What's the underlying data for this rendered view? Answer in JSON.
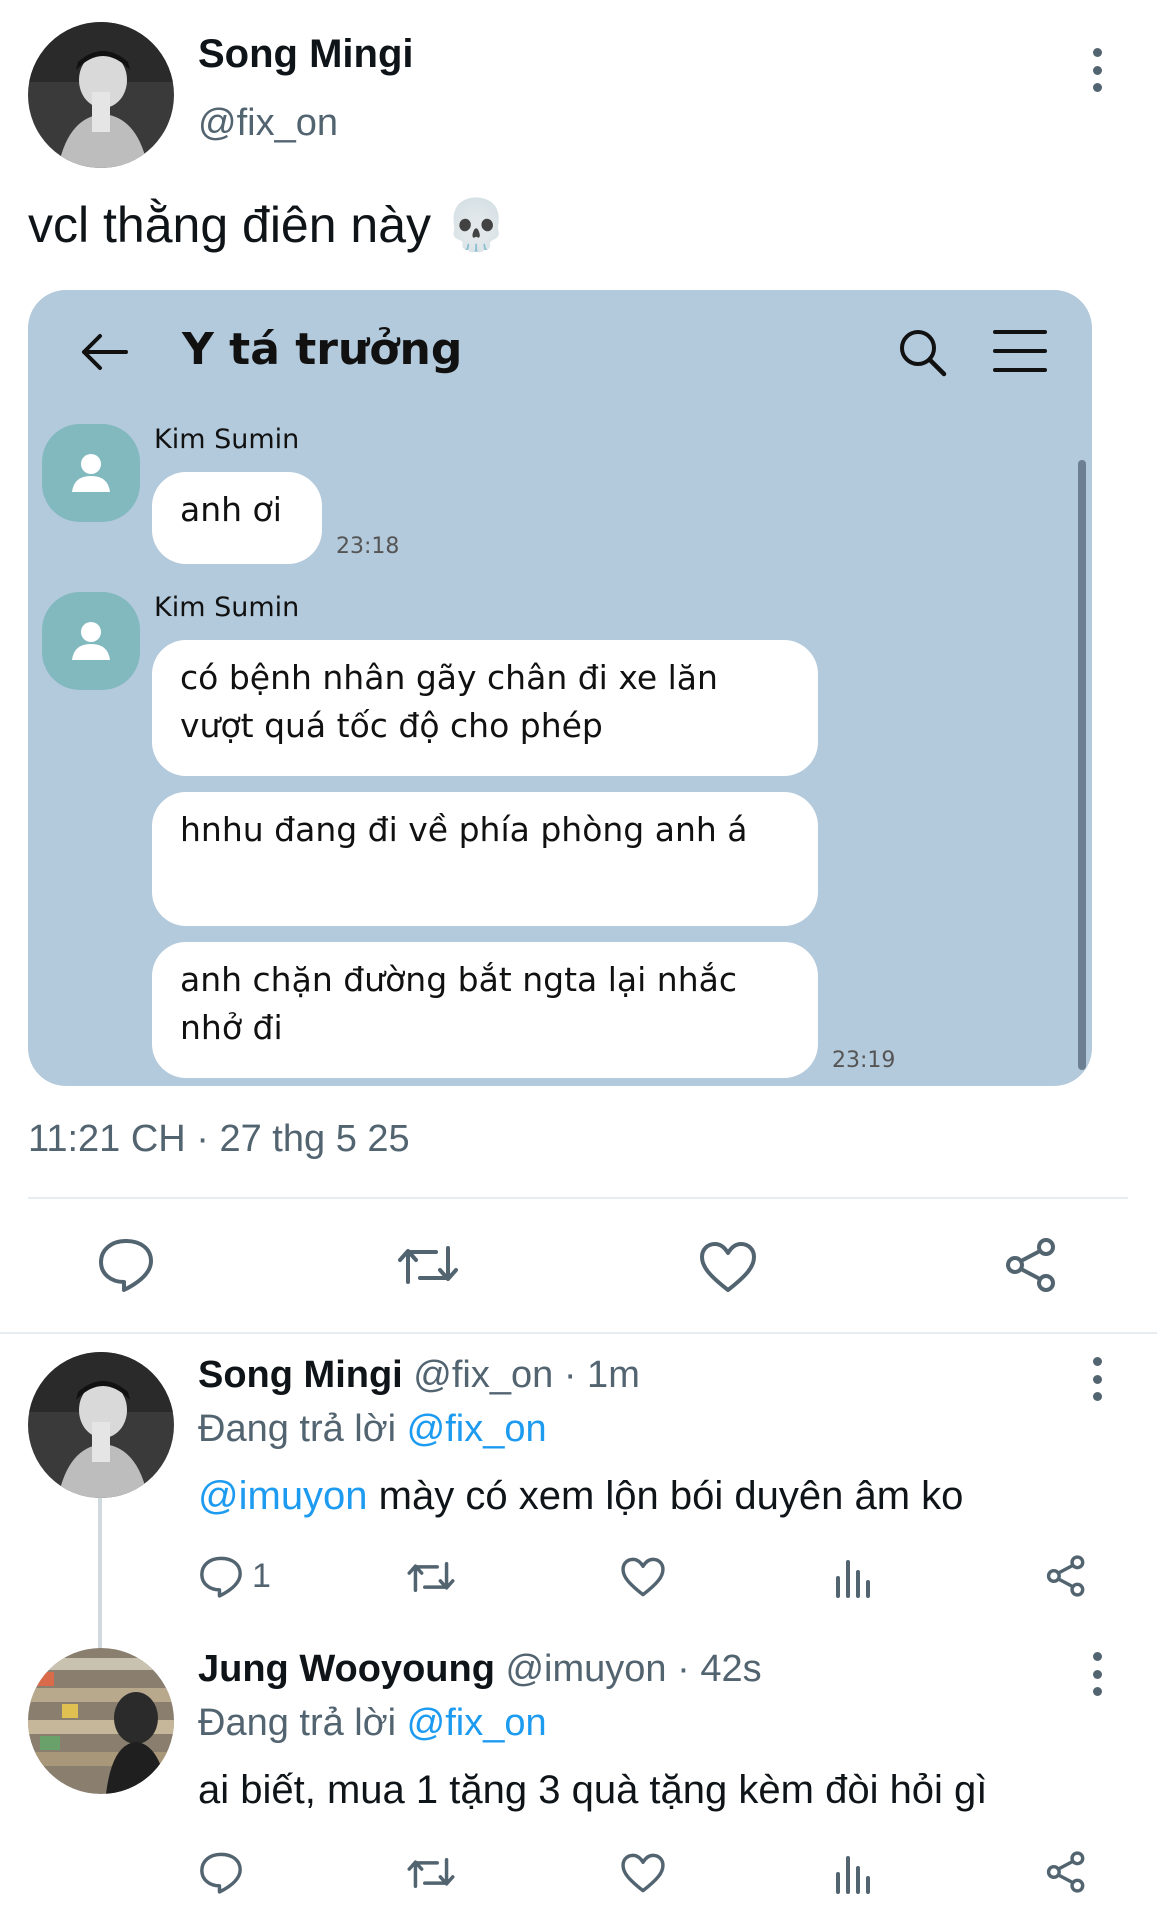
{
  "main_tweet": {
    "display_name": "Song Mingi",
    "handle": "@fix_on",
    "text": "vcl thằng điên này 💀",
    "timestamp": "11:21 CH · 27 thg 5 25"
  },
  "chat": {
    "title": "Y tá trưởng",
    "groups": [
      {
        "sender": "Kim Sumin",
        "messages": [
          "anh ơi"
        ],
        "time": "23:18"
      },
      {
        "sender": "Kim Sumin",
        "messages": [
          "có bệnh nhân gãy chân đi xe lăn vượt quá tốc độ cho phép",
          "hnhu đang đi về phía phòng anh á",
          "anh chặn đường bắt ngta lại nhắc nhở đi"
        ],
        "time": "23:19"
      }
    ]
  },
  "replies": [
    {
      "display_name": "Song Mingi",
      "handle": "@fix_on",
      "time": "· 1m",
      "replying_label": "Đang trả lời",
      "replying_to": "@fix_on",
      "mention": "@imuyon",
      "text": " mày có xem lộn bói duyên âm ko",
      "reply_count": "1"
    },
    {
      "display_name": "Jung Wooyoung",
      "handle": "@imuyon",
      "time": "· 42s",
      "replying_label": "Đang trả lời",
      "replying_to": "@fix_on",
      "text": "ai biết, mua 1 tặng 3 quà tặng kèm đòi hỏi gì",
      "reply_count": ""
    }
  ],
  "colors": {
    "accent": "#1d9bf0",
    "muted": "#536471",
    "chat_background": "#b3c9dc",
    "chat_avatar": "#82b9bf"
  }
}
